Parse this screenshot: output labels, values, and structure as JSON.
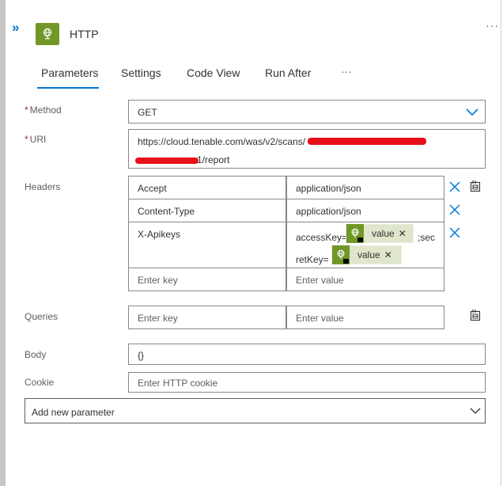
{
  "header": {
    "title": "HTTP",
    "expand_glyph": "»",
    "more_glyph": "···",
    "icon": "globe-icon",
    "accent_color": "#709727"
  },
  "tabs": [
    {
      "label": "Parameters",
      "active": true
    },
    {
      "label": "Settings"
    },
    {
      "label": "Code View"
    },
    {
      "label": "Run After"
    },
    {
      "label": "···"
    }
  ],
  "form": {
    "method": {
      "label": "Method",
      "required_mark": "*",
      "value": "GET"
    },
    "uri": {
      "label": "URI",
      "required_mark": "*",
      "line1_visible": "https://cloud.tenable.com/was/v2/scans/",
      "line2_visible": "1/report"
    },
    "headers": {
      "label": "Headers",
      "rows": [
        {
          "key": "Accept",
          "value": "application/json"
        },
        {
          "key": "Content-Type",
          "value": "application/json"
        }
      ],
      "apikey_row": {
        "key": "X-Apikeys",
        "value_prefix": "accessKey=",
        "token1_label": "value",
        "value_suffix": ";sec",
        "value_line2_prefix": "retKey=",
        "token2_label": "value"
      },
      "key_placeholder": "Enter key",
      "value_placeholder": "Enter value"
    },
    "queries": {
      "label": "Queries",
      "key_placeholder": "Enter key",
      "value_placeholder": "Enter value"
    },
    "body": {
      "label": "Body",
      "value": "{}"
    },
    "cookie": {
      "label": "Cookie",
      "placeholder": "Enter HTTP cookie"
    },
    "add_param": {
      "label": "Add new parameter"
    }
  },
  "colors": {
    "primary": "#0078d4",
    "required": "#a4262c",
    "redaction": "#e8101b",
    "token_bg": "#dfe6cc"
  }
}
